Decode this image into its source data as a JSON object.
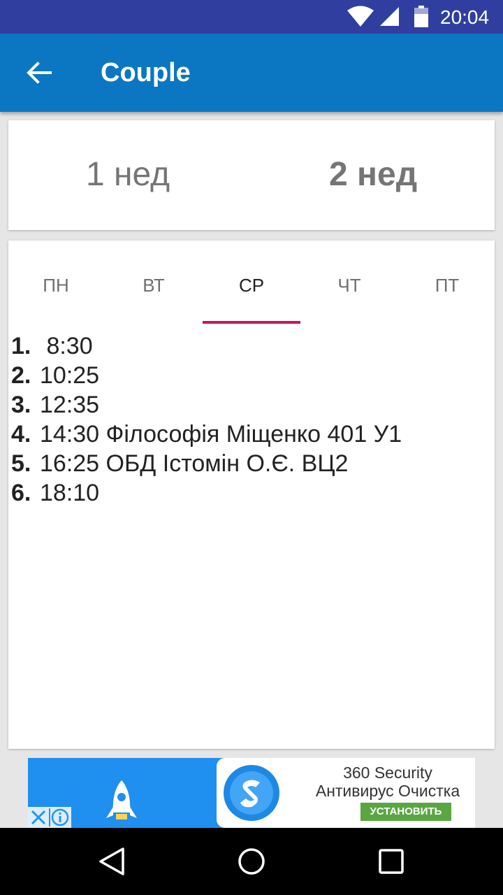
{
  "status_bar": {
    "time": "20:04"
  },
  "app_bar": {
    "title": "Couple",
    "back_icon": "arrow-back-icon"
  },
  "weeks": {
    "week1": "1 нед",
    "week2": "2 нед",
    "selected": "week2"
  },
  "days": {
    "tabs": [
      {
        "label": "ПН"
      },
      {
        "label": "ВТ"
      },
      {
        "label": "СР"
      },
      {
        "label": "ЧТ"
      },
      {
        "label": "ПТ"
      }
    ],
    "selected": "СР",
    "indicator_color": "#c2185b"
  },
  "lessons": [
    {
      "num": "1.",
      "text": " 8:30"
    },
    {
      "num": "2.",
      "text": "10:25"
    },
    {
      "num": "3.",
      "text": "12:35"
    },
    {
      "num": "4.",
      "text": "14:30 Філософія Міщенко 401 У1"
    },
    {
      "num": "5.",
      "text": "16:25 ОБД Істомін О.Є. ВЦ2"
    },
    {
      "num": "6.",
      "text": "18:10"
    }
  ],
  "ad": {
    "title": "360 Security",
    "subtitle": "Антивирус Очистка",
    "install_label": "УСТАНОВИТЬ"
  },
  "colors": {
    "status_bar": "#303f9f",
    "app_bar": "#0b77c2",
    "install_button": "#5aa641"
  }
}
